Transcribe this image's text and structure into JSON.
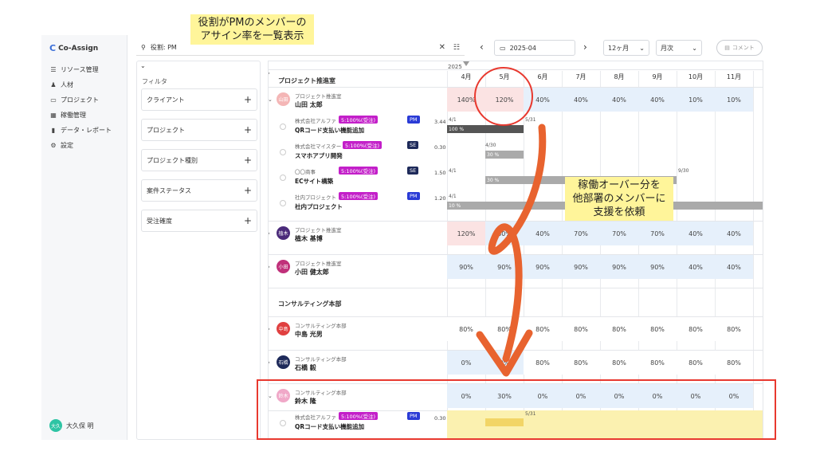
{
  "app": {
    "name": "Co-Assign"
  },
  "sidebar": {
    "items": [
      {
        "label": "リソース管理",
        "icon": "list-icon"
      },
      {
        "label": "人材",
        "icon": "people-icon"
      },
      {
        "label": "プロジェクト",
        "icon": "document-icon"
      },
      {
        "label": "稼働管理",
        "icon": "calendar-icon"
      },
      {
        "label": "データ・レポート",
        "icon": "bar-chart-icon"
      },
      {
        "label": "設定",
        "icon": "gear-icon"
      }
    ],
    "user": {
      "initials": "大久",
      "name": "大久保 明"
    }
  },
  "search": {
    "value": "役割: PM"
  },
  "toolbar": {
    "month": "2025-04",
    "span": "12ヶ月",
    "unit": "月次",
    "comment": "コメント"
  },
  "filter": {
    "title": "フィルタ",
    "items": [
      "クライアント",
      "プロジェクト",
      "プロジェクト種別",
      "案件ステータス",
      "受注確度"
    ]
  },
  "grid": {
    "year": "2025",
    "months": [
      "4月",
      "5月",
      "6月",
      "7月",
      "8月",
      "9月",
      "10月",
      "11月"
    ],
    "sections": [
      {
        "name": "プロジェクト推進室"
      },
      {
        "name": "コンサルティング本部"
      }
    ],
    "people": [
      {
        "avatar": "山田",
        "avatar_color": "#f4b6b6",
        "dept": "プロジェクト推進室",
        "name": "山田 太郎",
        "values": [
          "140%",
          "120%",
          "40%",
          "40%",
          "40%",
          "40%",
          "10%",
          "10%"
        ]
      },
      {
        "avatar": "植木",
        "avatar_color": "#4a2a7a",
        "dept": "プロジェクト推進室",
        "name": "植木 基博",
        "values": [
          "120%",
          "80%",
          "40%",
          "70%",
          "70%",
          "70%",
          "40%",
          "40%"
        ]
      },
      {
        "avatar": "小田",
        "avatar_color": "#c0307a",
        "dept": "プロジェクト推進室",
        "name": "小田 健太郎",
        "values": [
          "90%",
          "90%",
          "90%",
          "90%",
          "90%",
          "90%",
          "40%",
          "40%"
        ]
      },
      {
        "avatar": "中島",
        "avatar_color": "#e04040",
        "dept": "コンサルティング本部",
        "name": "中島 光男",
        "values": [
          "80%",
          "80%",
          "80%",
          "80%",
          "80%",
          "80%",
          "80%",
          "80%"
        ]
      },
      {
        "avatar": "石橋",
        "avatar_color": "#1e2a5a",
        "dept": "コンサルティング本部",
        "name": "石橋 毅",
        "values": [
          "0%",
          "0%",
          "80%",
          "80%",
          "80%",
          "80%",
          "80%",
          "80%"
        ]
      },
      {
        "avatar": "鈴木",
        "avatar_color": "#f0a8c8",
        "dept": "コンサルティング本部",
        "name": "鈴木 隆",
        "values": [
          "0%",
          "30%",
          "0%",
          "0%",
          "0%",
          "0%",
          "0%",
          "0%"
        ]
      }
    ],
    "projects": [
      {
        "client": "株式会社アルファ",
        "tag": "5:100%(受注)",
        "role": "PM",
        "name": "QRコード支払い機能追加",
        "hours": "3.44",
        "bar": "100 %",
        "start": "4/1",
        "end": "5/31"
      },
      {
        "client": "株式会社マイスター",
        "tag": "5:100%(受注)",
        "role": "SE",
        "name": "スマホアプリ開発",
        "hours": "0.30",
        "bar": "30 %",
        "start": "4/30",
        "end": ""
      },
      {
        "client": "〇〇商事",
        "tag": "5:100%(受注)",
        "role": "SE",
        "name": "ECサイト構築",
        "hours": "1.50",
        "bar": "30 %",
        "start": "4/1",
        "end": "9/30"
      },
      {
        "client": "社内プロジェクト",
        "tag": "5:100%(受注)",
        "role": "PM",
        "name": "社内プロジェクト",
        "hours": "1.20",
        "bar": "10 %",
        "start": "4/1",
        "end": ""
      },
      {
        "client": "株式会社アルファ",
        "tag": "5:100%(受注)",
        "role": "PM",
        "name": "QRコード支払い機能追加",
        "hours": "0.30",
        "bar": "",
        "start": "",
        "end": "5/31"
      }
    ]
  },
  "annotations": {
    "top": [
      "役割がPMのメンバーの",
      "アサイン率を一覧表示"
    ],
    "right": [
      "稼働オーバー分を",
      "他部署のメンバーに",
      "支援を依頼"
    ]
  },
  "colors": {
    "accent": "#3b6fd8",
    "alert": "#e8392f",
    "callout": "#fff59a",
    "arrow": "#e8632f",
    "magenta": "#c31fc9"
  }
}
